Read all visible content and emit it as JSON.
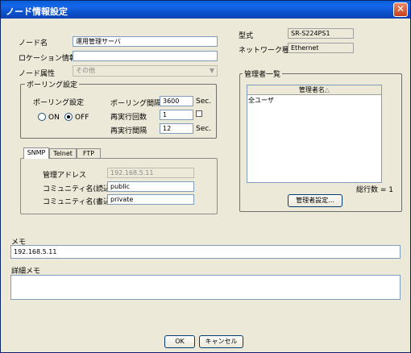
{
  "window": {
    "title": "ノード情報設定",
    "close_glyph": "✕"
  },
  "node_name": {
    "label": "ノード名",
    "value": "運用管理サーバ"
  },
  "location": {
    "label": "ロケーション情報",
    "value": ""
  },
  "attribute": {
    "label": "ノード属性",
    "value": "その他"
  },
  "model": {
    "label": "型式",
    "value": "SR-S224PS1"
  },
  "network_type": {
    "label": "ネットワーク種別",
    "value": "Ethernet"
  },
  "polling": {
    "group_label": "ポーリング設定",
    "setting_label": "ポーリング設定",
    "on_label": "ON",
    "off_label": "OFF",
    "selected": "OFF",
    "interval_label": "ポーリング間隔",
    "interval_value": "3600",
    "interval_unit": "Sec.",
    "retry_count_label": "再実行回数",
    "retry_count_value": "1",
    "retry_interval_label": "再実行間隔",
    "retry_interval_value": "12",
    "retry_interval_unit": "Sec."
  },
  "tabs": [
    {
      "label": "SNMP",
      "active": true
    },
    {
      "label": "Telnet",
      "active": false
    },
    {
      "label": "FTP",
      "active": false
    }
  ],
  "snmp": {
    "address_label": "管理アドレス",
    "address_value": "192.168.5.11",
    "community_read_label": "コミュニティ名(読込用)",
    "community_read_value": "public",
    "community_write_label": "コミュニティ名(書込用)",
    "community_write_value": "private"
  },
  "admins": {
    "group_label": "管理者一覧",
    "column_header": "管理者名",
    "sort_glyph": "△",
    "rows": [
      "全ユーザ"
    ],
    "row_count_text": "総行数 = 1",
    "settings_button": "管理者設定..."
  },
  "memo": {
    "label": "メモ",
    "value": "192.168.5.11"
  },
  "detail_memo": {
    "label": "詳細メモ",
    "value": ""
  },
  "footer": {
    "ok": "OK",
    "cancel": "キャンセル"
  }
}
